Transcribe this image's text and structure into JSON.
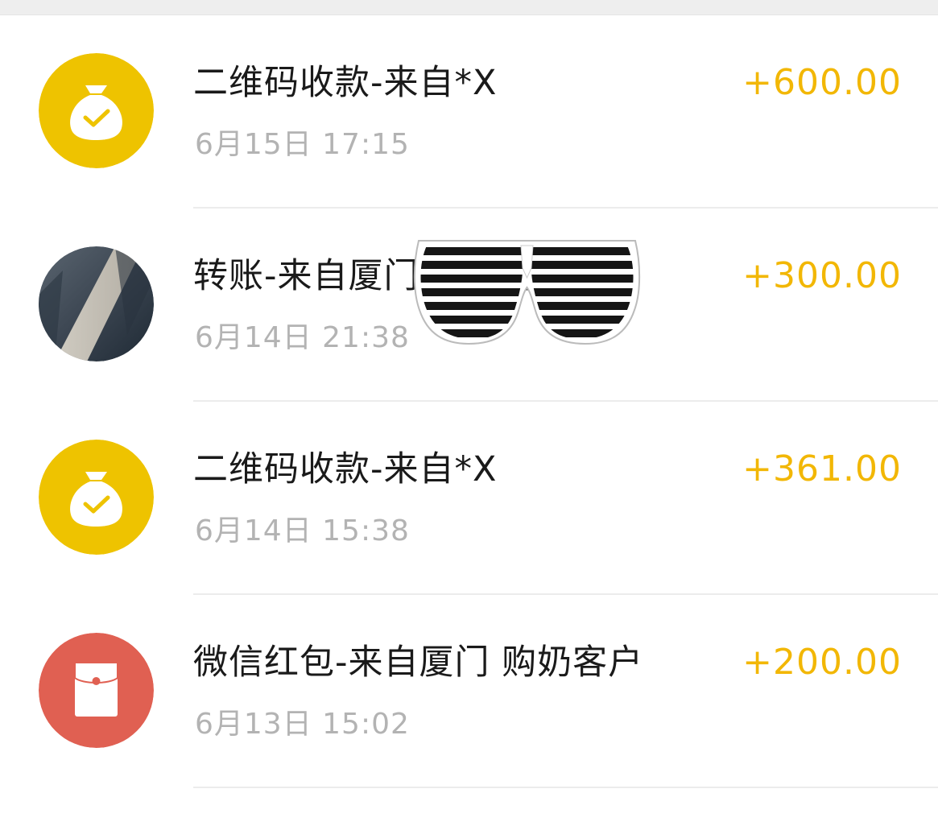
{
  "colors": {
    "amount": "#f2b705",
    "income_icon_bg": "#eec300",
    "red_packet_icon_bg": "#e06052",
    "title_text": "#1a1a1a",
    "time_text": "#b3b3b3"
  },
  "transactions": [
    {
      "icon": "money-bag-check-icon",
      "title": "二维码收款-来自*X",
      "time": "6月15日 17:15",
      "amount": "+600.00"
    },
    {
      "icon": "user-photo-avatar",
      "title": "转账-来自厦门 购奶客户",
      "time": "6月14日 21:38",
      "amount": "+300.00"
    },
    {
      "icon": "money-bag-check-icon",
      "title": "二维码收款-来自*X",
      "time": "6月14日 15:38",
      "amount": "+361.00"
    },
    {
      "icon": "red-packet-icon",
      "title": "微信红包-来自厦门 购奶客户",
      "time": "6月13日 15:02",
      "amount": "+200.00"
    }
  ],
  "overlay": {
    "icon": "shutter-shades-sticker"
  }
}
